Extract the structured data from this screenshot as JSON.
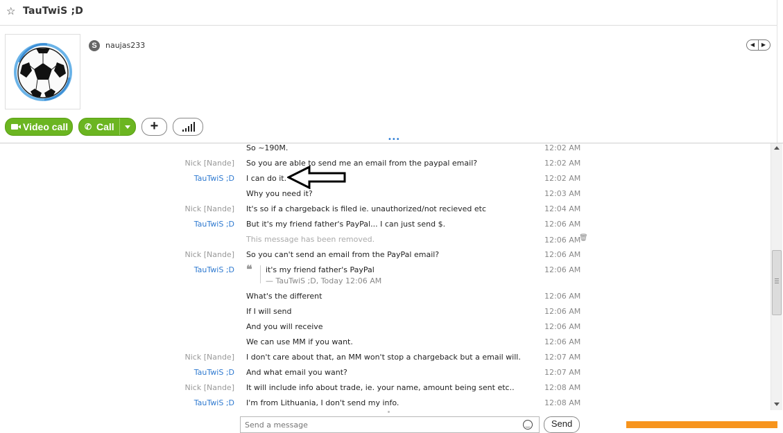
{
  "header": {
    "title": "TauTwiS ;D"
  },
  "profile": {
    "skype_name": "naujas233"
  },
  "actions": {
    "video_call": "Video call",
    "call": "Call"
  },
  "messages": [
    {
      "sender": "",
      "sender_type": "tau",
      "text": "So ~190M.",
      "time": "12:02 AM",
      "top": 0
    },
    {
      "sender": "Nick [Nande]",
      "sender_type": "nick",
      "text": "So you are able to send me an email from the paypal email?",
      "time": "12:02 AM"
    },
    {
      "sender": "TauTwiS ;D",
      "sender_type": "tau",
      "text": "I can do it.",
      "time": "12:02 AM"
    },
    {
      "sender": "",
      "sender_type": "tau",
      "text": "Why you need it?",
      "time": "12:03 AM"
    },
    {
      "sender": "Nick [Nande]",
      "sender_type": "nick",
      "text": "It's so if a chargeback is filed ie. unauthorized/not recieved etc",
      "time": "12:04 AM"
    },
    {
      "sender": "TauTwiS ;D",
      "sender_type": "tau",
      "text": "But it's my friend father's PayPal... I can just send $.",
      "time": "12:06 AM"
    },
    {
      "sender": "",
      "sender_type": "tau",
      "text": "This message has been removed.",
      "time": "12:06 AM",
      "removed": true
    },
    {
      "sender": "Nick [Nande]",
      "sender_type": "nick",
      "text": "So you can't send an email from the PayPal email?",
      "time": "12:06 AM"
    },
    {
      "sender": "TauTwiS ;D",
      "sender_type": "tau",
      "quote": true,
      "quote_text": "it's my friend father's PayPal",
      "quote_meta": "— TauTwiS ;D, Today 12:06 AM",
      "time": "12:06 AM"
    },
    {
      "sender": "",
      "sender_type": "tau",
      "text": "What's the different",
      "time": "12:06 AM"
    },
    {
      "sender": "",
      "sender_type": "tau",
      "text": "If I will send",
      "time": "12:06 AM"
    },
    {
      "sender": "",
      "sender_type": "tau",
      "text": "And you will receive",
      "time": "12:06 AM"
    },
    {
      "sender": "",
      "sender_type": "tau",
      "text": "We can use MM if you want.",
      "time": "12:06 AM"
    },
    {
      "sender": "Nick [Nande]",
      "sender_type": "nick",
      "text": "I don't care about that, an MM won't stop a chargeback but a email will.",
      "time": "12:07 AM"
    },
    {
      "sender": "TauTwiS ;D",
      "sender_type": "tau",
      "text": "And what email you want?",
      "time": "12:07 AM"
    },
    {
      "sender": "Nick [Nande]",
      "sender_type": "nick",
      "text": "It will include info about trade, ie. your name, amount being sent etc..",
      "time": "12:08 AM"
    },
    {
      "sender": "TauTwiS ;D",
      "sender_type": "tau",
      "text": "I'm from Lithuania, I don't send my info.",
      "time": "12:08 AM"
    }
  ],
  "composer": {
    "placeholder": "Send a message",
    "send_label": "Send"
  },
  "icons": {
    "favorite": "star-icon",
    "skype": "skype-icon",
    "video": "video-camera-icon",
    "phone": "phone-icon",
    "add": "plus-icon",
    "signal": "signal-bars-icon",
    "delete": "trash-icon",
    "quote": "quote-icon",
    "emoji": "smiley-icon"
  },
  "colors": {
    "accent_green": "#6bb521",
    "sender_blue": "#2f7ad0",
    "sender_gray": "#999999",
    "orange": "#f7941d"
  }
}
